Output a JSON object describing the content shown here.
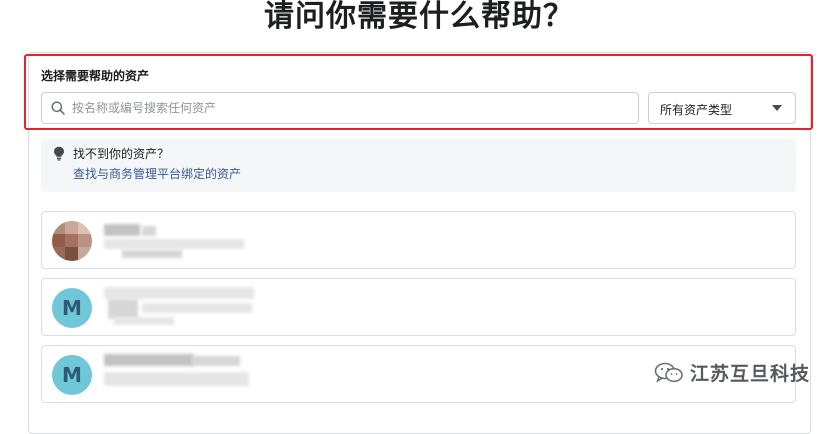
{
  "page": {
    "title": "请问你需要什么帮助？"
  },
  "asset_picker": {
    "section_label": "选择需要帮助的资产",
    "search": {
      "placeholder": "按名称或编号搜索任何资产",
      "value": ""
    },
    "type_filter": {
      "selected": "所有资产类型"
    }
  },
  "hint": {
    "title": "找不到你的资产？",
    "link": "查找与商务管理平台绑定的资产"
  },
  "assets": [
    {
      "avatar_type": "photo",
      "avatar_letter": ""
    },
    {
      "avatar_type": "letter",
      "avatar_letter": "M"
    },
    {
      "avatar_type": "letter",
      "avatar_letter": "M"
    }
  ],
  "watermark": {
    "text": "江苏互旦科技"
  },
  "colors": {
    "highlight_border": "#e5242a",
    "link": "#385898",
    "avatar_bg": "#6fc7d7",
    "avatar_text": "#2e5a78",
    "hint_bg": "#f5f6f7"
  }
}
